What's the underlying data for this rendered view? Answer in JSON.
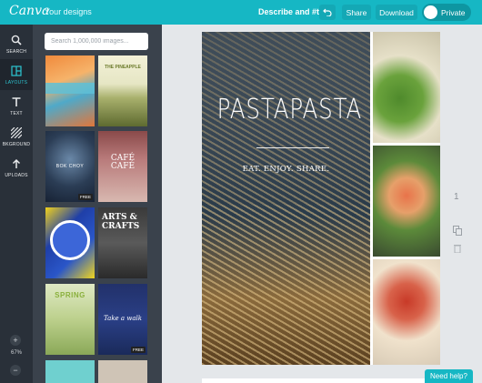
{
  "topbar": {
    "logo": "Canva",
    "your_designs": "Your designs",
    "design_title": "Describe and #tag",
    "share": "Share",
    "download": "Download",
    "privacy": "Private"
  },
  "rail": {
    "search": "SEARCH",
    "layouts": "LAYOUTS",
    "text": "TEXT",
    "background": "BKGROUND",
    "uploads": "UPLOADS",
    "zoom_in": "+",
    "zoom_level": "67%",
    "zoom_out": "−"
  },
  "panel": {
    "search_placeholder": "Search 1,000,000 images...",
    "thumbnails": [
      {
        "text": ""
      },
      {
        "text": "THE PINEAPPLE"
      },
      {
        "text": "BOK CHOY",
        "badge": "FREE"
      },
      {
        "text": "CAFÉ CAFÉ"
      },
      {
        "text": ""
      },
      {
        "text": "ARTS & CRAFTS"
      },
      {
        "text": "SPRING"
      },
      {
        "text": "Take a walk",
        "badge": "FREE"
      }
    ]
  },
  "canvas": {
    "headline": "PASTAPASTA",
    "subline": "EAT. ENJOY. SHARE.",
    "page_number": "1"
  },
  "help": "Need help?"
}
